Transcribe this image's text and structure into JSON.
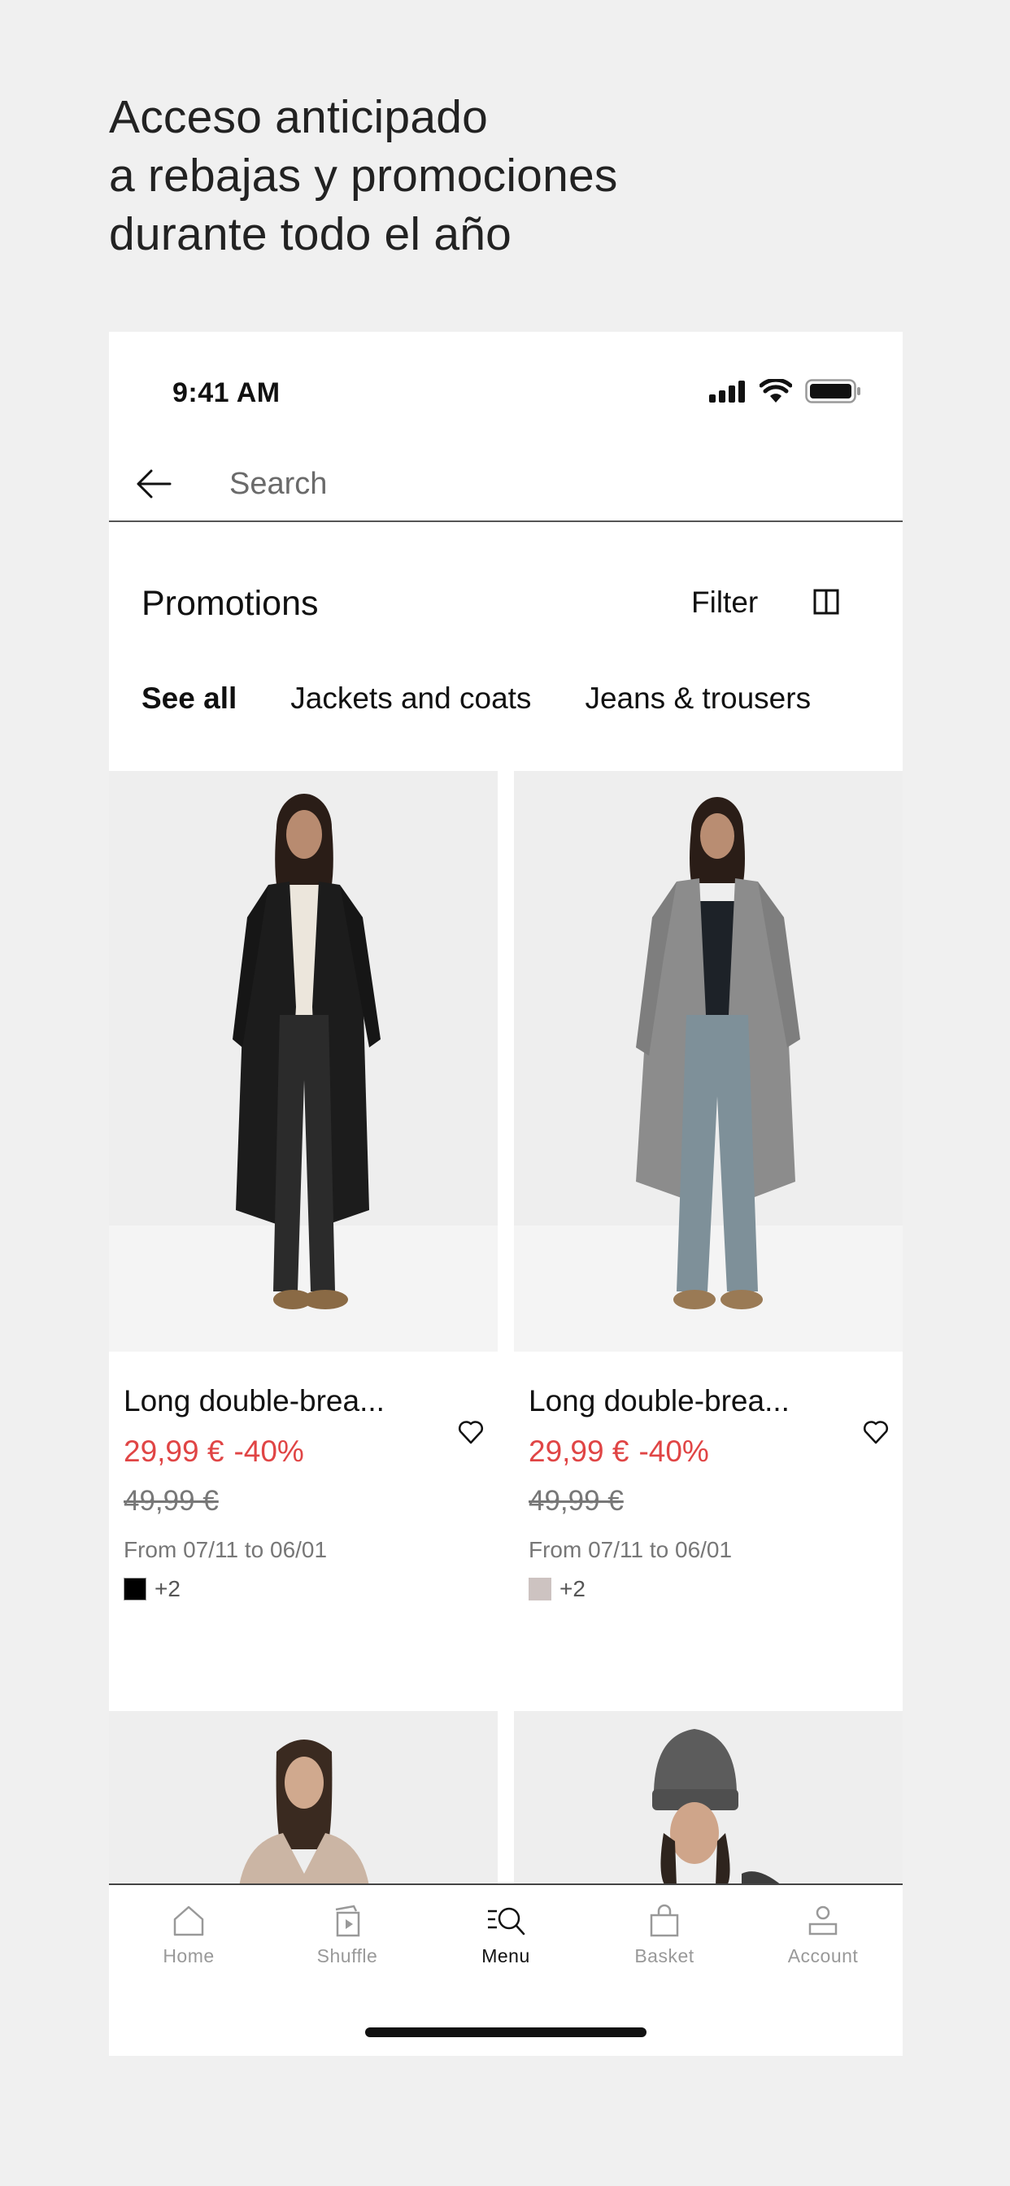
{
  "headline": {
    "line1": "Acceso anticipado",
    "line2": "a rebajas y promociones",
    "line3": "durante todo el año"
  },
  "status_bar": {
    "time": "9:41 AM",
    "icons": [
      "signal-icon",
      "wifi-icon",
      "battery-icon"
    ]
  },
  "search": {
    "placeholder": "Search",
    "back_icon": "arrow-left-icon"
  },
  "section": {
    "title": "Promotions",
    "filter_label": "Filter",
    "grid_icon": "grid-view-icon"
  },
  "tabs": [
    {
      "label": "See all",
      "active": true
    },
    {
      "label": "Jackets and coats",
      "active": false
    },
    {
      "label": "Jeans & trousers",
      "active": false
    }
  ],
  "products": [
    {
      "name": "Long double-brea...",
      "price": "29,99 €",
      "discount": "-40%",
      "old_price": "49,99 €",
      "dates": "From 07/11 to 06/01",
      "swatch_color": "#000000",
      "more_colors": "+2",
      "image": "model in long black double-breasted coat"
    },
    {
      "name": "Long double-brea...",
      "price": "29,99 €",
      "discount": "-40%",
      "old_price": "49,99 €",
      "dates": "From 07/11 to 06/01",
      "swatch_color": "#cdc3c1",
      "more_colors": "+2",
      "image": "model in long grey double-breasted coat"
    },
    {
      "image": "model in beige v-neck sweater"
    },
    {
      "image": "model in grey knit beanie"
    }
  ],
  "colors": {
    "sale_red": "#e04545",
    "background": "#f0f0f0",
    "text": "#111111",
    "muted": "#777777"
  },
  "bottom_nav": [
    {
      "label": "Home",
      "icon": "home-icon",
      "active": false
    },
    {
      "label": "Shuffle",
      "icon": "shuffle-icon",
      "active": false
    },
    {
      "label": "Menu",
      "icon": "menu-search-icon",
      "active": true
    },
    {
      "label": "Basket",
      "icon": "basket-icon",
      "active": false
    },
    {
      "label": "Account",
      "icon": "account-icon",
      "active": false
    }
  ]
}
